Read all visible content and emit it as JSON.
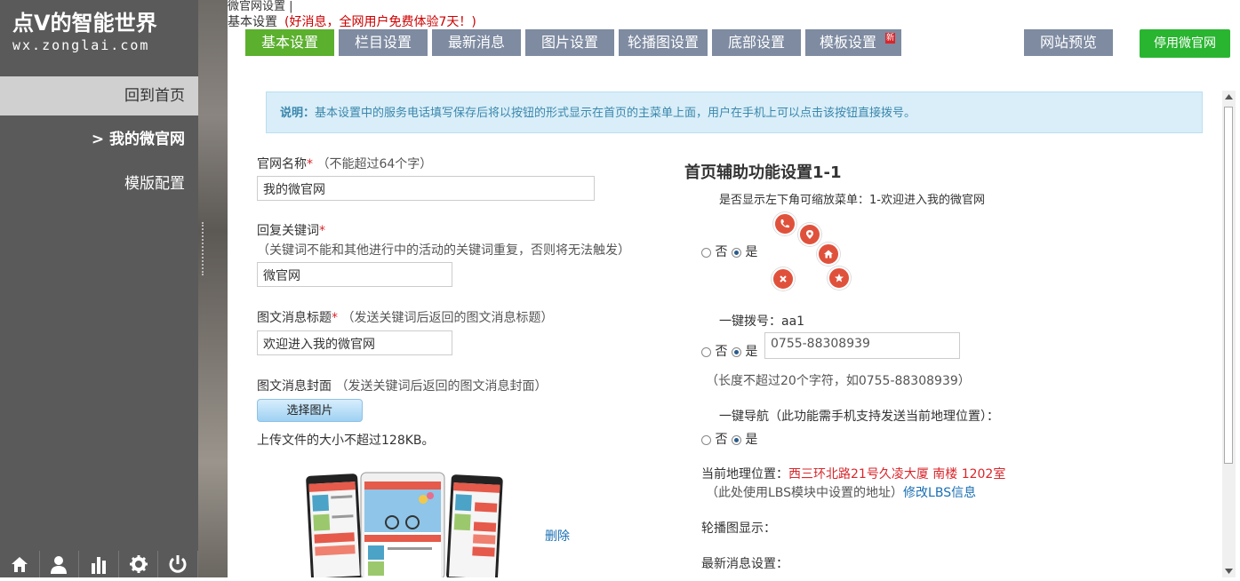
{
  "sidebar": {
    "brand_title": "点V的智能世界",
    "brand_url": "wx.zonglai.com",
    "items": [
      {
        "label": "回到首页"
      },
      {
        "label": ">  我的微官网"
      },
      {
        "label": "模版配置"
      }
    ],
    "bottom_icons": [
      "home-icon",
      "user-icon",
      "chart-icon",
      "gear-icon",
      "power-icon"
    ]
  },
  "header": {
    "crumb": "微官网设置 |",
    "subtitle": "基本设置",
    "promo": "(好消息，全网用户免费体验7天！)"
  },
  "tabs": [
    {
      "label": "基本设置"
    },
    {
      "label": "栏目设置"
    },
    {
      "label": "最新消息"
    },
    {
      "label": "图片设置"
    },
    {
      "label": "轮播图设置"
    },
    {
      "label": "底部设置"
    },
    {
      "label": "模板设置",
      "badge": "新"
    }
  ],
  "actions": {
    "preview": "网站预览",
    "disable": "停用微官网"
  },
  "notice": {
    "prefix": "说明：",
    "text": "基本设置中的服务电话填写保存后将以按钮的形式显示在首页的主菜单上面，用户在手机上可以点击该按钮直接拨号。"
  },
  "form": {
    "site_name": {
      "label": "官网名称",
      "req": "*",
      "hint": "（不能超过64个字）",
      "value": "我的微官网"
    },
    "keyword": {
      "label": "回复关键词",
      "req": "*",
      "hint": "（关键词不能和其他进行中的活动的关键词重复，否则将无法触发）",
      "value": "微官网"
    },
    "msg_title": {
      "label": "图文消息标题",
      "req": "*",
      "hint": "（发送关键词后返回的图文消息标题）",
      "value": "欢迎进入我的微官网"
    },
    "msg_cover": {
      "label": "图文消息封面",
      "hint": "（发送关键词后返回的图文消息封面）",
      "button": "选择图片",
      "note": "上传文件的大小不超过128KB。"
    },
    "delete_link": "删除"
  },
  "aux": {
    "title": "首页辅助功能设置1-1",
    "menu_label": "是否显示左下角可缩放菜单：1-欢迎进入我的微官网",
    "no": "否",
    "yes": "是",
    "dial_label": "一键拨号：aa1",
    "dial_value": "0755-88308939",
    "dial_hint": "（长度不超过20个字符，如0755-88308939）",
    "nav_label": "一键导航（此功能需手机支持发送当前地理位置）：",
    "location_label": "当前地理位置：",
    "location_value": "西三环北路21号久凌大厦 南楼 1202室",
    "lbs_hint": "（此处使用LBS模块中设置的地址）",
    "lbs_link": "修改LBS信息",
    "carousel_label": "轮播图显示：",
    "news_label": "最新消息设置："
  },
  "colors": {
    "sidebar": "#5a5a5a",
    "tab": "#7e8ba1",
    "tab_active": "#5bb02e",
    "disable_btn": "#2ab531",
    "required": "#d9262b",
    "fab": "#e0513c",
    "link": "#1a6fb3"
  }
}
